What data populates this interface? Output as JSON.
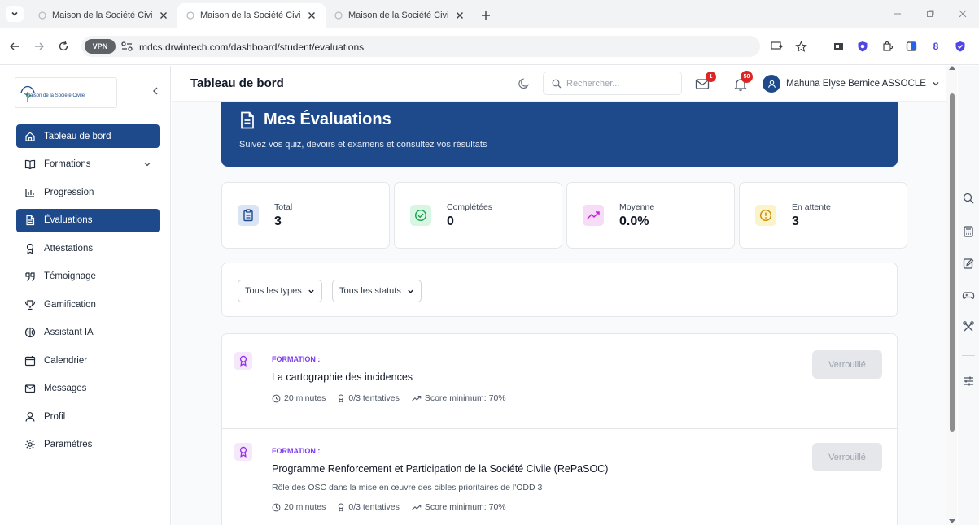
{
  "browser": {
    "tabs": [
      {
        "title": "Maison de la Société Civile - Pla",
        "active": false
      },
      {
        "title": "Maison de la Société Civile - Pla",
        "active": true
      },
      {
        "title": "Maison de la Société Civile - Pla",
        "active": false
      }
    ],
    "vpn_label": "VPN",
    "url": "mdcs.drwintech.com/dashboard/student/evaluations",
    "extension_count": "8"
  },
  "sidebar": {
    "logo_text": "Maison de la Société Civile",
    "items": [
      {
        "label": "Tableau de bord",
        "icon": "home-icon",
        "active": true
      },
      {
        "label": "Formations",
        "icon": "book-icon",
        "active": false,
        "has_submenu": true
      },
      {
        "label": "Progression",
        "icon": "bar-chart-icon",
        "active": false
      },
      {
        "label": "Évaluations",
        "icon": "file-text-icon",
        "active": true
      },
      {
        "label": "Attestations",
        "icon": "award-icon",
        "active": false
      },
      {
        "label": "Témoignage",
        "icon": "quote-icon",
        "active": false
      },
      {
        "label": "Gamification",
        "icon": "trophy-icon",
        "active": false
      },
      {
        "label": "Assistant IA",
        "icon": "brain-icon",
        "active": false
      },
      {
        "label": "Calendrier",
        "icon": "calendar-icon",
        "active": false
      },
      {
        "label": "Messages",
        "icon": "mail-icon",
        "active": false
      },
      {
        "label": "Profil",
        "icon": "user-icon",
        "active": false
      },
      {
        "label": "Paramètres",
        "icon": "gear-icon",
        "active": false
      }
    ]
  },
  "header": {
    "title": "Tableau de bord",
    "search_placeholder": "Rechercher...",
    "messages_badge": "1",
    "notifications_badge": "50",
    "user_name": "Mahuna Elyse Bernice ASSOCLE"
  },
  "hero": {
    "title": "Mes Évaluations",
    "subtitle": "Suivez vos quiz, devoirs et examens et consultez vos résultats"
  },
  "stats": [
    {
      "label": "Total",
      "value": "3",
      "icon": "clipboard-icon",
      "color": "#dbe4f5"
    },
    {
      "label": "Complétées",
      "value": "0",
      "icon": "check-circle-icon",
      "color": "#d9f5e3"
    },
    {
      "label": "Moyenne",
      "value": "0.0%",
      "icon": "trending-up-icon",
      "color": "#f6dcf6"
    },
    {
      "label": "En attente",
      "value": "3",
      "icon": "alert-circle-icon",
      "color": "#fbf4c9"
    }
  ],
  "filters": {
    "type_selected": "Tous les types",
    "status_selected": "Tous les statuts"
  },
  "evaluations": [
    {
      "type": "FORMATION :",
      "title": "La cartographie des incidences",
      "description": "",
      "duration": "20 minutes",
      "attempts": "0/3 tentatives",
      "min_score": "Score minimum: 70%",
      "button": "Verrouillé"
    },
    {
      "type": "FORMATION :",
      "title": "Programme Renforcement et Participation de la Société Civile (RePaSOC)",
      "description": "Rôle des OSC dans la mise en œuvre des cibles prioritaires de l'ODD 3",
      "duration": "20 minutes",
      "attempts": "0/3 tentatives",
      "min_score": "Score minimum: 70%",
      "button": "Verrouillé"
    }
  ],
  "colors": {
    "primary": "#1e4a8b",
    "accent_purple": "#7c3aed",
    "badge_red": "#dc2626"
  }
}
